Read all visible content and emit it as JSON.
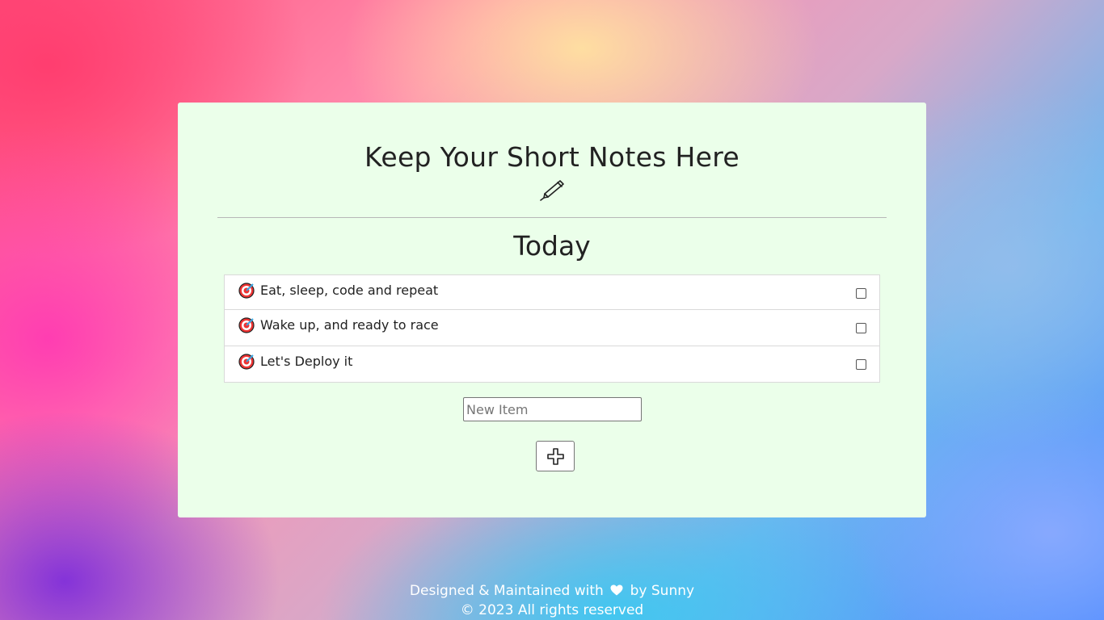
{
  "page": {
    "title": "Keep Your Short Notes Here",
    "pen_icon": "pen-icon"
  },
  "list": {
    "heading": "Today",
    "bullet_icon": "target-icon",
    "items": [
      {
        "text": "Eat, sleep, code and repeat",
        "checked": false
      },
      {
        "text": "Wake up, and ready to race",
        "checked": false
      },
      {
        "text": "Let's Deploy it",
        "checked": false
      }
    ]
  },
  "form": {
    "input_value": "",
    "input_placeholder": "New Item",
    "add_button_icon": "plus-icon"
  },
  "footer": {
    "line1_prefix": "Designed & Maintained with",
    "heart_icon": "heart-icon",
    "line1_suffix": "by Sunny",
    "line2": "© 2023 All rights reserved"
  },
  "colors": {
    "card_background": "#ebffea",
    "text": "#222222",
    "footer_text": "#ffffff"
  }
}
